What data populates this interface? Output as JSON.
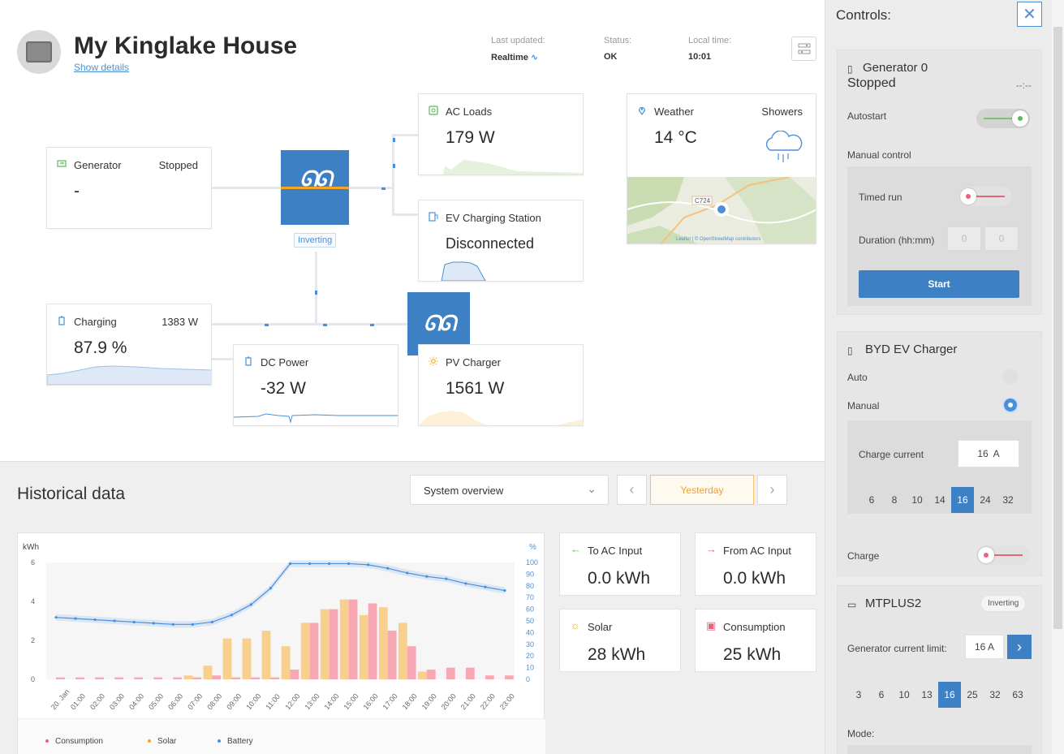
{
  "header": {
    "site_name": "My Kinglake House",
    "show_details": "Show details",
    "last_updated_label": "Last updated:",
    "last_updated_value": "Realtime",
    "status_label": "Status:",
    "status_value": "OK",
    "local_time_label": "Local time:",
    "local_time_value": "10:01"
  },
  "diagram": {
    "generator": {
      "label": "Generator",
      "state": "Stopped",
      "value": "-"
    },
    "inverter_status": "Inverting",
    "ac_loads": {
      "label": "AC Loads",
      "value": "179 W"
    },
    "ev_station": {
      "label": "EV Charging Station",
      "value": "Disconnected"
    },
    "weather": {
      "label": "Weather",
      "condition": "Showers",
      "temp": "14 °C",
      "map_road": "C724",
      "map_credit": "Leaflet | © OpenStreetMap contributors"
    },
    "battery": {
      "label": "Charging",
      "power": "1383 W",
      "soc": "87.9 %"
    },
    "dc_power": {
      "label": "DC Power",
      "value": "-32 W"
    },
    "pv_charger": {
      "label": "PV Charger",
      "value": "1561 W"
    }
  },
  "historical": {
    "title": "Historical data",
    "select_value": "System overview",
    "period": "Yesterday",
    "stats": {
      "to_ac": {
        "label": "To AC Input",
        "value": "0.0 kWh"
      },
      "from_ac": {
        "label": "From AC Input",
        "value": "0.0 kWh"
      },
      "solar": {
        "label": "Solar",
        "value": "28 kWh"
      },
      "consumption": {
        "label": "Consumption",
        "value": "25 kWh"
      }
    },
    "legend": [
      "Consumption",
      "Solar",
      "Battery"
    ]
  },
  "chart_data": {
    "type": "bar",
    "ylabel": "kWh",
    "y2label": "%",
    "ylim": [
      0,
      6
    ],
    "y2lim": [
      0,
      100
    ],
    "yticks": [
      "0",
      "2",
      "4",
      "6"
    ],
    "y2ticks": [
      "0",
      "10",
      "20",
      "30",
      "40",
      "50",
      "60",
      "70",
      "80",
      "90",
      "100"
    ],
    "categories": [
      "20. Jan",
      "01:00",
      "02:00",
      "03:00",
      "04:00",
      "05:00",
      "06:00",
      "07:00",
      "08:00",
      "09:00",
      "10:00",
      "11:00",
      "12:00",
      "13:00",
      "14:00",
      "15:00",
      "16:00",
      "17:00",
      "18:00",
      "19:00",
      "20:00",
      "21:00",
      "22:00",
      "23:00"
    ],
    "series": [
      {
        "name": "Consumption",
        "color": "#f7a8b4",
        "values": [
          0.1,
          0.1,
          0.1,
          0.1,
          0.1,
          0.1,
          0.1,
          0.1,
          0.2,
          0.1,
          0.1,
          0.1,
          0.5,
          2.9,
          3.6,
          4.1,
          3.9,
          2.5,
          1.7,
          0.5,
          0.6,
          0.6,
          0.2,
          0.2
        ]
      },
      {
        "name": "Solar",
        "color": "#f9cf8e",
        "values": [
          0,
          0,
          0,
          0,
          0,
          0,
          0,
          0.2,
          0.7,
          2.1,
          2.1,
          2.5,
          1.7,
          2.9,
          3.6,
          4.1,
          3.3,
          3.7,
          2.9,
          0.4,
          0,
          0,
          0,
          0
        ]
      },
      {
        "name": "Battery",
        "color": "#4a90d9",
        "values": [
          53,
          52,
          51,
          50,
          49,
          48,
          47,
          47,
          49,
          55,
          64,
          78,
          99,
          99,
          99,
          99,
          98,
          95,
          91,
          88,
          86,
          82,
          79,
          76
        ]
      }
    ]
  },
  "controls": {
    "title": "Controls:",
    "generator": {
      "name": "Generator 0",
      "state": "Stopped",
      "state_timer": "--:--",
      "autostart_label": "Autostart",
      "manual_label": "Manual control",
      "timed_run_label": "Timed run",
      "duration_label": "Duration (hh:mm)",
      "duration_h": "0",
      "duration_m": "0",
      "start_label": "Start"
    },
    "ev_charger": {
      "name": "BYD EV Charger",
      "auto_label": "Auto",
      "manual_label": "Manual",
      "charge_current_label": "Charge current",
      "charge_current_value": "16",
      "charge_current_unit": "A",
      "current_options": [
        "6",
        "8",
        "10",
        "14",
        "16",
        "24",
        "32"
      ],
      "selected_current": "16",
      "charge_label": "Charge"
    },
    "mtplus": {
      "name": "MTPLUS2",
      "state": "Inverting",
      "gen_limit_label": "Generator current limit:",
      "gen_limit_value": "16 A",
      "limit_options": [
        "3",
        "6",
        "10",
        "13",
        "16",
        "25",
        "32",
        "63"
      ],
      "selected_limit": "16",
      "mode_label": "Mode:"
    }
  }
}
